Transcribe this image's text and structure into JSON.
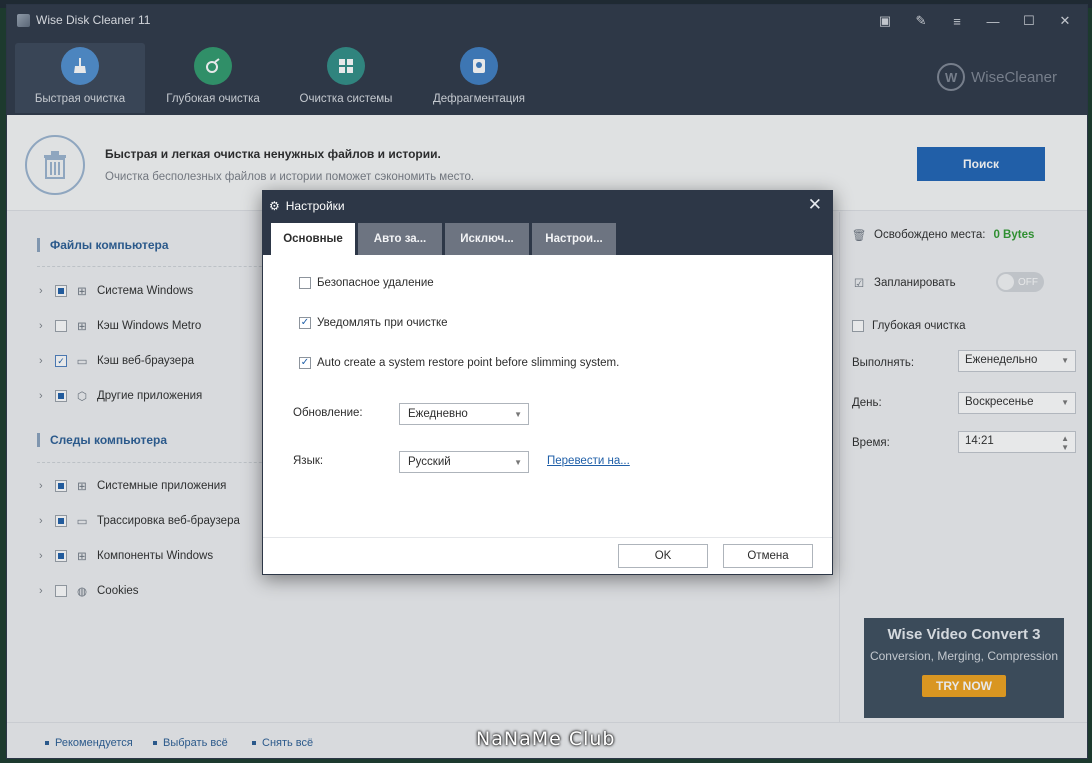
{
  "app": {
    "title": "Wise Disk Cleaner 11",
    "brand": "WiseCleaner"
  },
  "window_controls": [
    "▣",
    "✎",
    "≡",
    "—",
    "☐",
    "✕"
  ],
  "nav_tabs": [
    {
      "label": "Быстрая очистка",
      "icon": "broom-icon",
      "active": true
    },
    {
      "label": "Глубокая очистка",
      "icon": "deep-scan-icon",
      "active": false
    },
    {
      "label": "Очистка системы",
      "icon": "windows-icon",
      "active": false
    },
    {
      "label": "Дефрагментация",
      "icon": "disk-defrag-icon",
      "active": false
    }
  ],
  "banner": {
    "title": "Быстрая и легкая очистка ненужных файлов и истории.",
    "subtitle": "Очистка бесполезных файлов и истории поможет сэкономить место.",
    "search_label": "Поиск"
  },
  "left": {
    "section1_title": "Файлы компьютера",
    "section1_items": [
      {
        "label": "Система Windows",
        "state": "partial",
        "icon": "windows-icon"
      },
      {
        "label": "Кэш Windows Metro",
        "state": "none",
        "icon": "metro-icon"
      },
      {
        "label": "Кэш веб-браузера",
        "state": "checked",
        "icon": "browser-icon"
      },
      {
        "label": "Другие приложения",
        "state": "partial",
        "icon": "box-icon"
      }
    ],
    "section2_title": "Следы компьютера",
    "section2_items": [
      {
        "label": "Системные приложения",
        "state": "partial",
        "icon": "windows-icon"
      },
      {
        "label": "Трассировка веб-браузера",
        "state": "partial",
        "icon": "browser-icon"
      },
      {
        "label": "Компоненты Windows",
        "state": "partial",
        "icon": "windows-icon"
      },
      {
        "label": "Cookies",
        "state": "none",
        "icon": "cookie-icon"
      }
    ]
  },
  "right": {
    "freed_label": "Освобождено места:",
    "freed_value": "0 Bytes",
    "schedule_label": "Запланировать",
    "toggle_state": "OFF",
    "deep_clean_label": "Глубокая очистка",
    "run_label": "Выполнять:",
    "run_value": "Еженедельно",
    "day_label": "День:",
    "day_value": "Воскресенье",
    "time_label": "Время:",
    "time_value": "14:21",
    "ad_title": "Wise Video Convert 3",
    "ad_subtitle": "Conversion, Merging, Compression",
    "ad_button": "TRY NOW"
  },
  "footer": {
    "recommended": "Рекомендуется",
    "select_all": "Выбрать всё",
    "deselect_all": "Снять всё"
  },
  "watermark": "NaNaMe Club",
  "modal": {
    "title": "Настройки",
    "tabs": [
      "Основные",
      "Авто за...",
      "Исключ...",
      "Настрои..."
    ],
    "active_tab": 0,
    "secure_delete": "Безопасное удаление",
    "secure_delete_checked": false,
    "notify": "Уведомлять при очистке",
    "notify_checked": true,
    "restore_point": "Auto create a system restore point before slimming system.",
    "restore_point_checked": true,
    "update_label": "Обновление:",
    "update_value": "Ежедневно",
    "language_label": "Язык:",
    "language_value": "Русский",
    "translate_link": "Перевести на...",
    "ok": "OK",
    "cancel": "Отмена"
  },
  "colors": {
    "accent": "#1e63b5",
    "titlebar": "#2d3747",
    "link": "#2a5d94",
    "freed": "#2f9a2f",
    "ad_button": "#f0a21c"
  }
}
